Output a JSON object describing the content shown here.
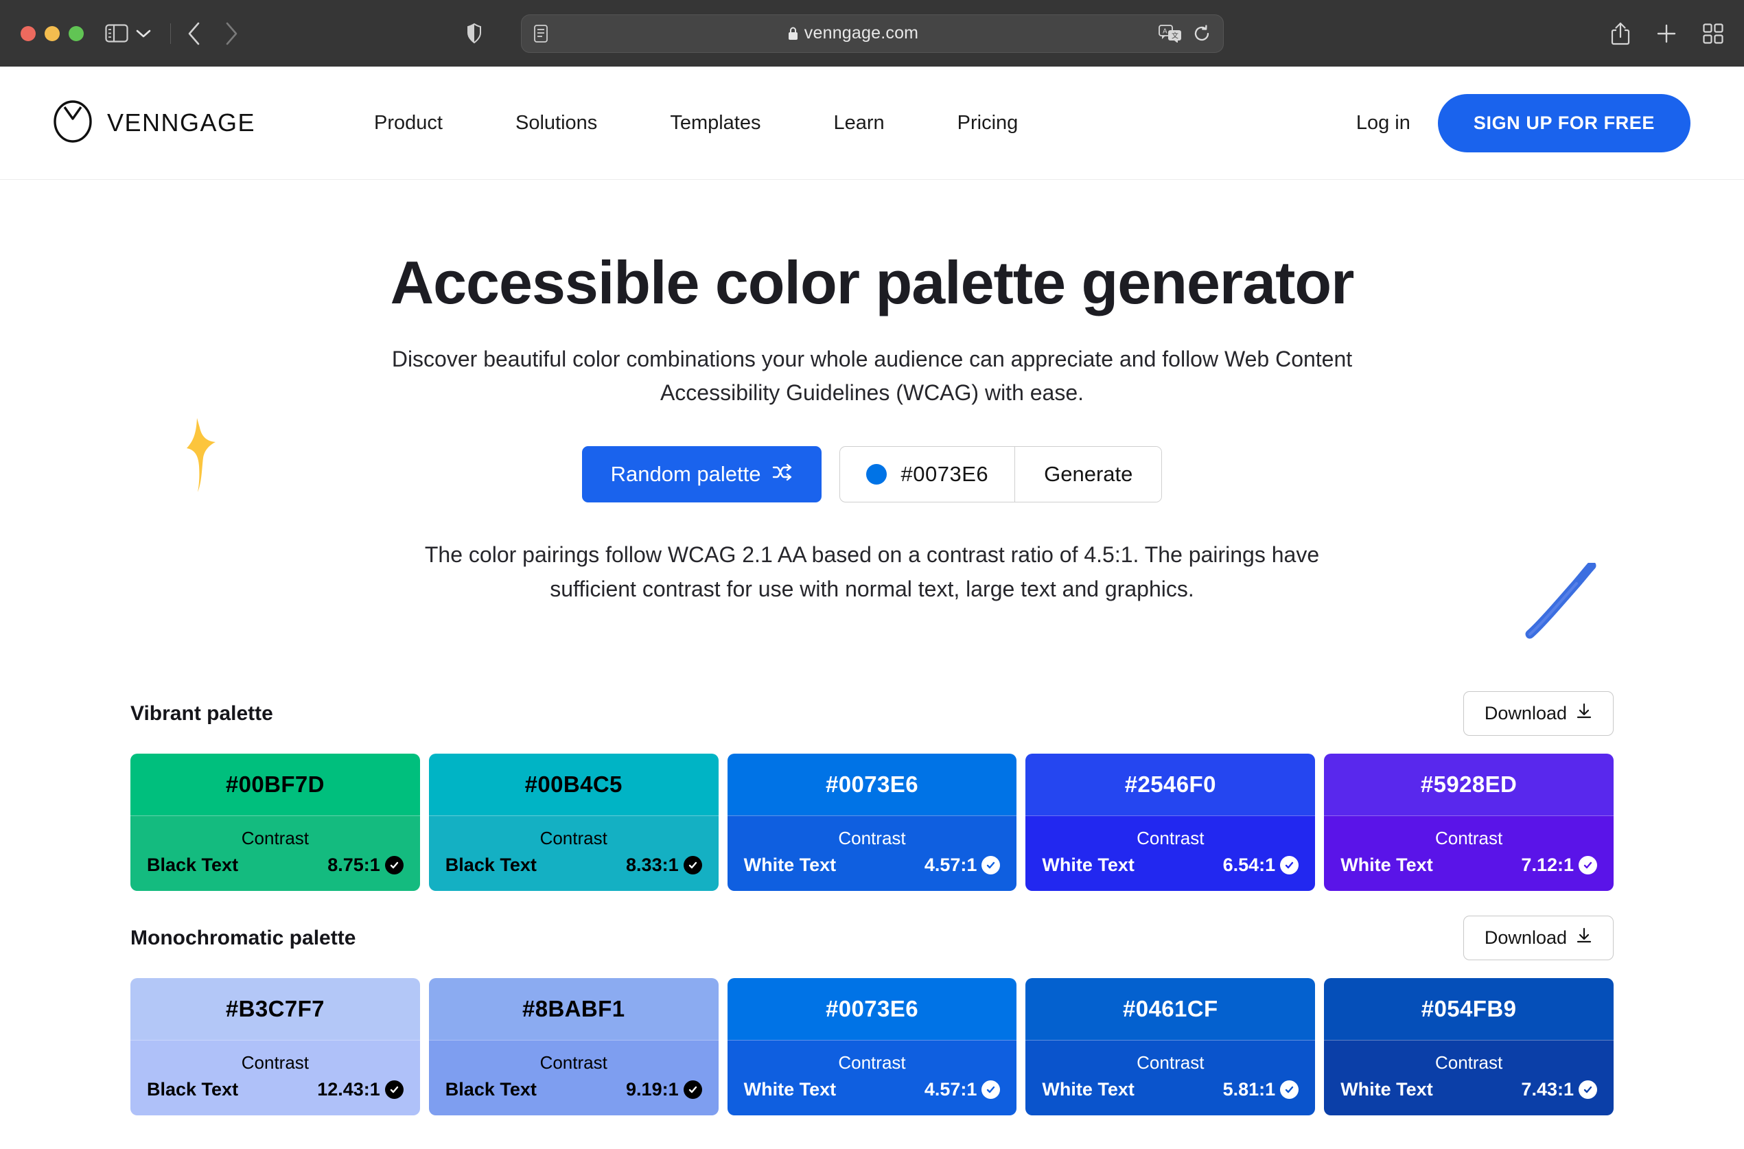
{
  "browser": {
    "url": "venngage.com",
    "icons": {
      "sidebar": "sidebar-toggle-icon",
      "chevron": "chevron-down-icon",
      "back": "back-arrow-icon",
      "forward": "forward-arrow-icon",
      "shield": "privacy-shield-icon",
      "reader": "reader-view-icon",
      "lock": "lock-icon",
      "translate": "translate-icon",
      "reload": "reload-icon",
      "share": "share-icon",
      "newtab": "plus-icon",
      "tabs": "tab-overview-icon"
    }
  },
  "site_nav": {
    "brand": "VENNGAGE",
    "links": [
      "Product",
      "Solutions",
      "Templates",
      "Learn",
      "Pricing"
    ],
    "login_label": "Log in",
    "signup_label": "SIGN UP FOR FREE",
    "accent_color": "#1a63ed"
  },
  "hero": {
    "title": "Accessible color palette generator",
    "subtitle": "Discover beautiful color combinations your whole audience can appreciate and follow Web Content Accessibility Guidelines (WCAG) with ease.",
    "note": "The color pairings follow WCAG 2.1 AA based on a contrast ratio of 4.5:1. The pairings have sufficient contrast for use with normal text, large text and graphics.",
    "random_label": "Random palette",
    "shuffle_icon": "shuffle-icon",
    "hex_value": "#0073E6",
    "hex_swatch_color": "#0073E6",
    "generate_label": "Generate",
    "sparkle_color": "#fcc53d",
    "swoosh_color": "#3b6ee0"
  },
  "palettes": [
    {
      "title": "Vibrant palette",
      "download_label": "Download",
      "download_icon": "download-icon",
      "contrast_label": "Contrast",
      "swatches": [
        {
          "hex": "#00BF7D",
          "bottom_hex": "#14BB7F",
          "text_mode": "Black Text",
          "ratio": "8.75:1",
          "text_color": "#000000",
          "check_fill": "#000000",
          "check_mark": "#ffffff"
        },
        {
          "hex": "#00B4C5",
          "bottom_hex": "#14B0C3",
          "text_mode": "Black Text",
          "ratio": "8.33:1",
          "text_color": "#000000",
          "check_fill": "#000000",
          "check_mark": "#ffffff"
        },
        {
          "hex": "#0073E6",
          "bottom_hex": "#0F5FE0",
          "text_mode": "White Text",
          "ratio": "4.57:1",
          "text_color": "#ffffff",
          "check_fill": "#ffffff",
          "check_mark": "#0F5FE0"
        },
        {
          "hex": "#2546F0",
          "bottom_hex": "#2228F0",
          "text_mode": "White Text",
          "ratio": "6.54:1",
          "text_color": "#ffffff",
          "check_fill": "#ffffff",
          "check_mark": "#2228F0"
        },
        {
          "hex": "#5928ED",
          "bottom_hex": "#5A14E8",
          "text_mode": "White Text",
          "ratio": "7.12:1",
          "text_color": "#ffffff",
          "check_fill": "#ffffff",
          "check_mark": "#5A14E8"
        }
      ]
    },
    {
      "title": "Monochromatic palette",
      "download_label": "Download",
      "download_icon": "download-icon",
      "contrast_label": "Contrast",
      "swatches": [
        {
          "hex": "#B3C7F7",
          "bottom_hex": "#AFC1F9",
          "text_mode": "Black Text",
          "ratio": "12.43:1",
          "text_color": "#000000",
          "check_fill": "#000000",
          "check_mark": "#ffffff"
        },
        {
          "hex": "#8BABF1",
          "bottom_hex": "#7E9EF0",
          "text_mode": "Black Text",
          "ratio": "9.19:1",
          "text_color": "#000000",
          "check_fill": "#000000",
          "check_mark": "#ffffff"
        },
        {
          "hex": "#0073E6",
          "bottom_hex": "#0F5FE0",
          "text_mode": "White Text",
          "ratio": "4.57:1",
          "text_color": "#ffffff",
          "check_fill": "#ffffff",
          "check_mark": "#0F5FE0"
        },
        {
          "hex": "#0461CF",
          "bottom_hex": "#0A54CC",
          "text_mode": "White Text",
          "ratio": "5.81:1",
          "text_color": "#ffffff",
          "check_fill": "#ffffff",
          "check_mark": "#0A54CC"
        },
        {
          "hex": "#054FB9",
          "bottom_hex": "#0B3FA8",
          "text_mode": "White Text",
          "ratio": "7.43:1",
          "text_color": "#ffffff",
          "check_fill": "#ffffff",
          "check_mark": "#0B3FA8"
        }
      ]
    }
  ]
}
